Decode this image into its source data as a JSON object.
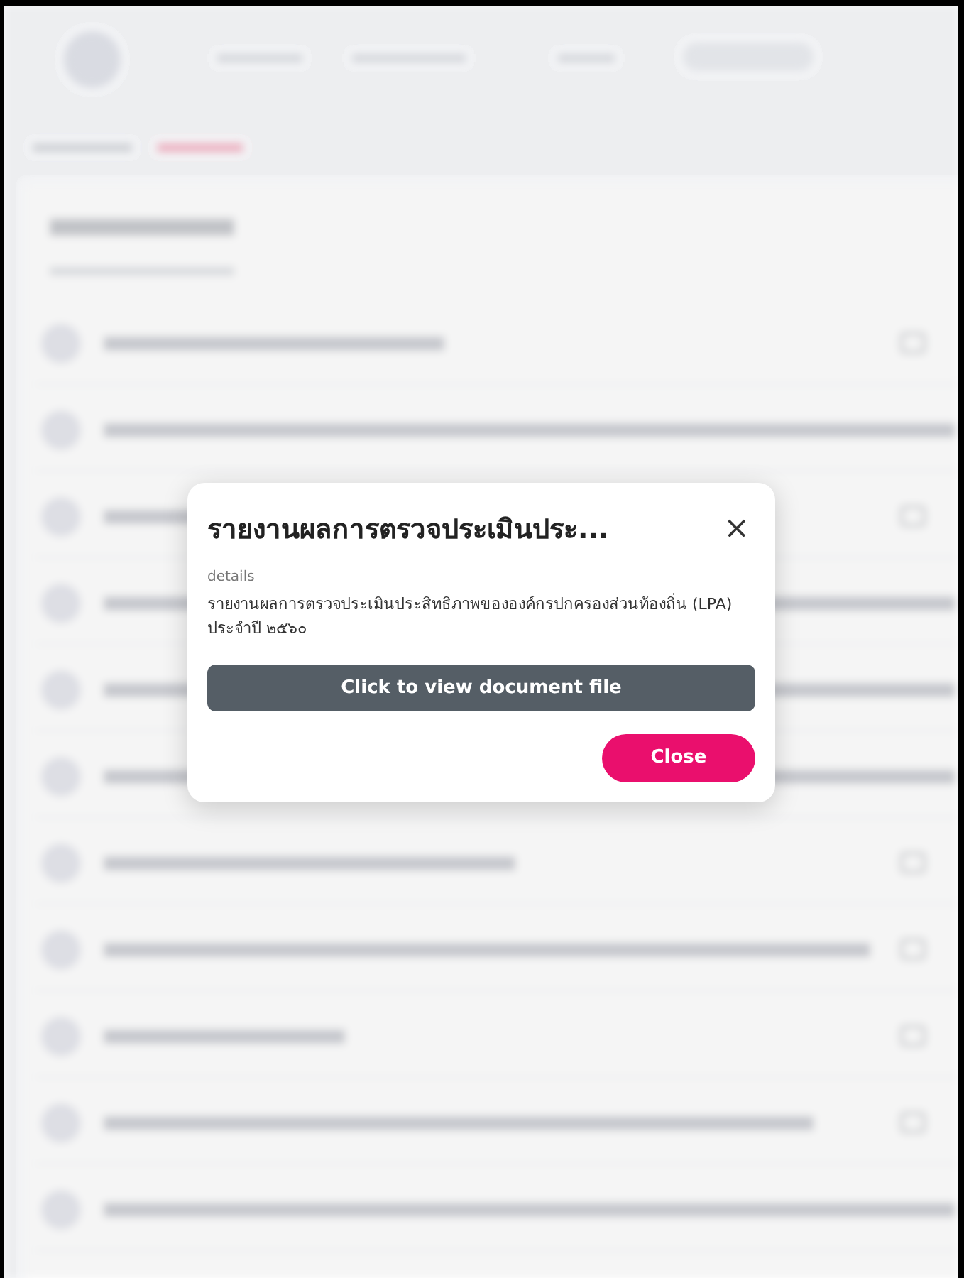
{
  "modal": {
    "title": "รายงานผลการตรวจประเมินประ...",
    "close_icon": "×",
    "details_label": "details",
    "description": "รายงานผลการตรวจประเมินประสิทธิภาพขององค์กรปกครองส่วนท้องถิ่น (LPA) ประจำปี ๒๕๖๐",
    "buttons": [
      {
        "label": "Click to view document file",
        "kind": "secondary"
      },
      {
        "label": "Close",
        "kind": "primary"
      }
    ]
  }
}
